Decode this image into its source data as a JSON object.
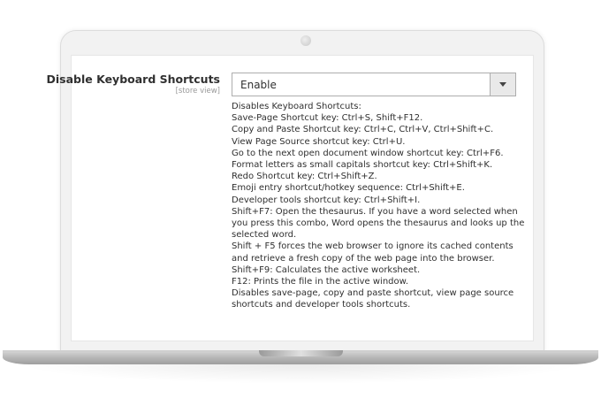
{
  "field": {
    "label": "Disable Keyboard Shortcuts",
    "scope": "[store view]",
    "value": "Enable"
  },
  "note_lines": [
    "Disables Keyboard Shortcuts:",
    "Save-Page Shortcut key: Ctrl+S, Shift+F12.",
    "Copy and Paste Shortcut key: Ctrl+C, Ctrl+V, Ctrl+Shift+C.",
    "View Page Source shortcut key: Ctrl+U.",
    "Go to the next open document window shortcut key: Ctrl+F6.",
    "Format letters as small capitals shortcut key: Ctrl+Shift+K.",
    "Redo Shortcut key: Ctrl+Shift+Z.",
    "Emoji entry shortcut/hotkey sequence: Ctrl+Shift+E.",
    "Developer tools shortcut key: Ctrl+Shift+I.",
    "Shift+F7: Open the thesaurus. If you have a word selected when",
    "you press this combo, Word opens the thesaurus and looks up the",
    "selected word.",
    "Shift + F5 forces the web browser to ignore its cached contents",
    "and retrieve a fresh copy of the web page into the browser.",
    "Shift+F9: Calculates the active worksheet.",
    "F12: Prints the file in the active window.",
    "Disables save-page, copy and paste shortcut, view page source",
    "shortcuts and developer tools shortcuts."
  ]
}
